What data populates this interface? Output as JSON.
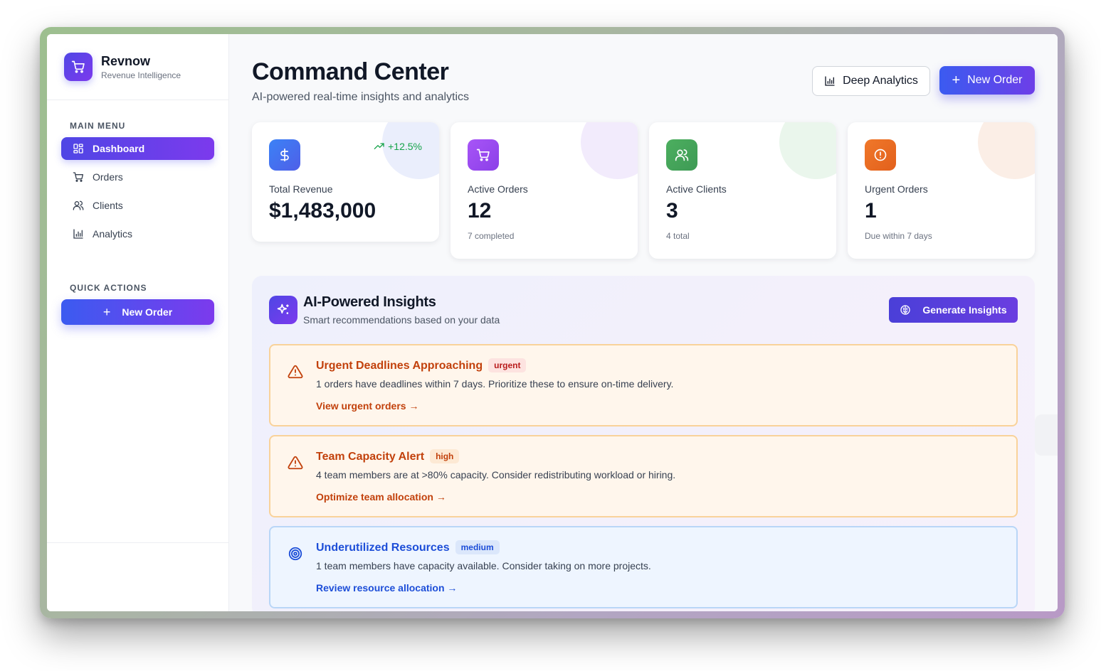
{
  "brand": {
    "name": "Revnow",
    "subtitle": "Revenue Intelligence",
    "icon": "cart-icon"
  },
  "sidebar": {
    "main_menu_label": "MAIN MENU",
    "items": [
      {
        "label": "Dashboard",
        "icon": "dashboard-icon",
        "active": true
      },
      {
        "label": "Orders",
        "icon": "cart-icon"
      },
      {
        "label": "Clients",
        "icon": "users-icon"
      },
      {
        "label": "Analytics",
        "icon": "bar-chart-icon"
      }
    ],
    "quick_actions_label": "QUICK ACTIONS",
    "quick_action_button": "New Order"
  },
  "header": {
    "title": "Command Center",
    "subtitle": "AI-powered real-time insights and analytics",
    "deep_analytics_label": "Deep Analytics",
    "new_order_label": "New Order"
  },
  "stats": [
    {
      "label": "Total Revenue",
      "value": "$1,483,000",
      "trend": "+12.5%",
      "icon": "dollar-icon",
      "color": "#3b6cf0"
    },
    {
      "label": "Active Orders",
      "value": "12",
      "sub": "7 completed",
      "icon": "cart-icon",
      "color": "#9b4df0"
    },
    {
      "label": "Active Clients",
      "value": "3",
      "sub": "4 total",
      "icon": "users-icon",
      "color": "#3fa55a"
    },
    {
      "label": "Urgent Orders",
      "value": "1",
      "sub": "Due within 7 days",
      "icon": "alert-circle-icon",
      "color": "#ea6a1f"
    }
  ],
  "insights": {
    "title": "AI-Powered Insights",
    "subtitle": "Smart recommendations based on your data",
    "generate_label": "Generate Insights",
    "items": [
      {
        "title": "Urgent Deadlines Approaching",
        "badge": "urgent",
        "description": "1 orders have deadlines within 7 days. Prioritize these to ensure on-time delivery.",
        "link": "View urgent orders →",
        "icon": "warning-triangle-icon"
      },
      {
        "title": "Team Capacity Alert",
        "badge": "high",
        "description": "4 team members are at >80% capacity. Consider redistributing workload or hiring.",
        "link": "Optimize team allocation →",
        "icon": "warning-triangle-icon"
      },
      {
        "title": "Underutilized Resources",
        "badge": "medium",
        "description": "1 team members have capacity available. Consider taking on more projects.",
        "link": "Review resource allocation →",
        "icon": "target-icon"
      }
    ]
  }
}
